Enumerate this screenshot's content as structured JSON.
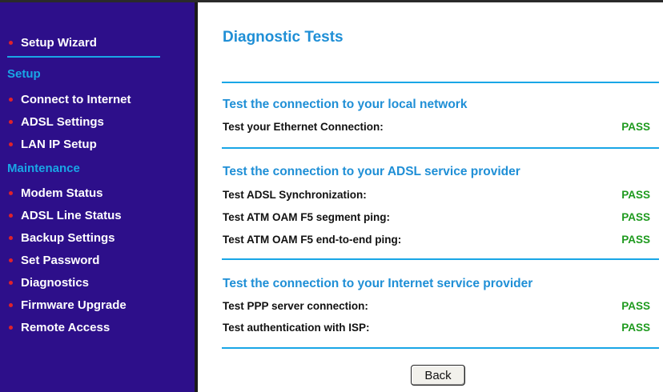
{
  "sidebar": {
    "wizard_label": "Setup Wizard",
    "setup_heading": "Setup",
    "setup_items": [
      "Connect to Internet",
      "ADSL Settings",
      "LAN IP Setup"
    ],
    "maintenance_heading": "Maintenance",
    "maintenance_items": [
      "Modem Status",
      "ADSL Line Status",
      "Backup Settings",
      "Set Password",
      "Diagnostics",
      "Firmware Upgrade",
      "Remote Access"
    ]
  },
  "main": {
    "title": "Diagnostic Tests",
    "sections": [
      {
        "title": "Test the connection to your local network",
        "rows": [
          {
            "label": "Test your Ethernet Connection:",
            "result": "PASS"
          }
        ]
      },
      {
        "title": "Test the connection to your ADSL service provider",
        "rows": [
          {
            "label": "Test ADSL Synchronization:",
            "result": "PASS"
          },
          {
            "label": "Test ATM OAM F5 segment ping:",
            "result": "PASS"
          },
          {
            "label": "Test ATM OAM F5 end-to-end ping:",
            "result": "PASS"
          }
        ]
      },
      {
        "title": "Test the connection to your Internet service provider",
        "rows": [
          {
            "label": "Test PPP server connection:",
            "result": "PASS"
          },
          {
            "label": "Test authentication with ISP:",
            "result": "PASS"
          }
        ]
      }
    ],
    "back_label": "Back"
  },
  "colors": {
    "sidebar_bg": "#2d0f8a",
    "accent_blue": "#1f8fd6",
    "pass_green": "#1e9a1e",
    "bullet_red": "#e0222a"
  }
}
